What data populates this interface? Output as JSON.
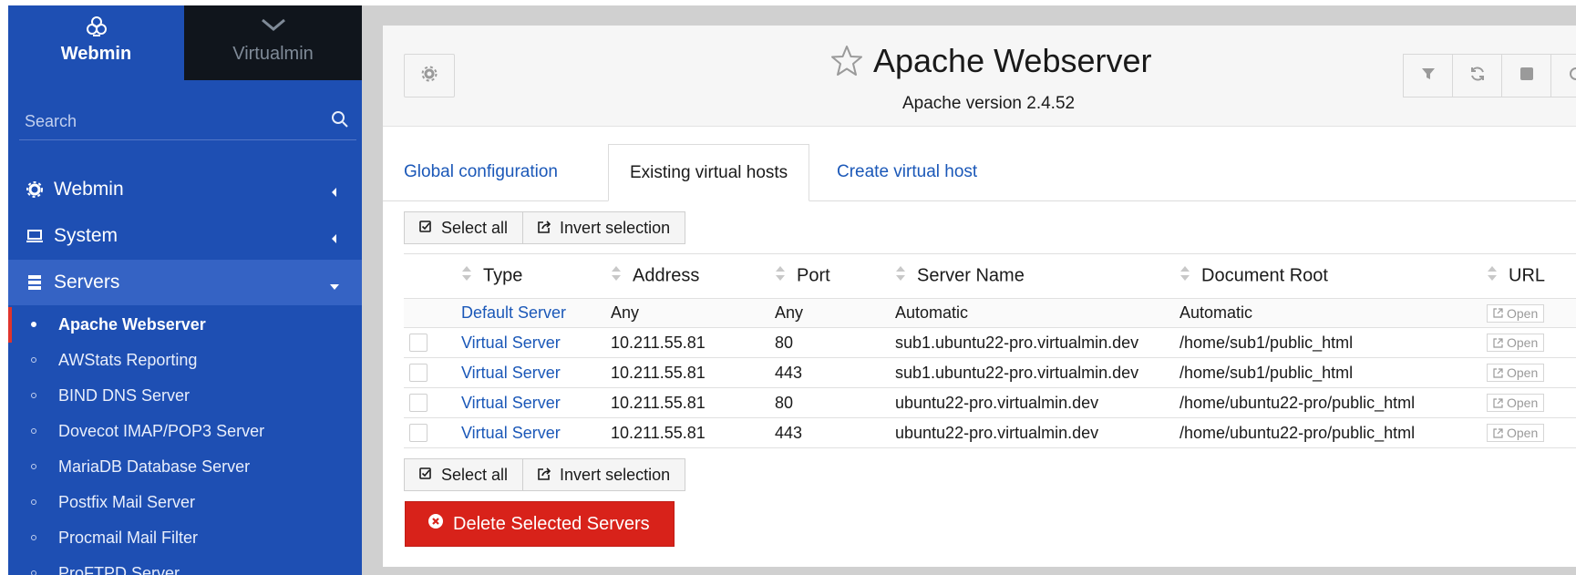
{
  "sidebar": {
    "switch": {
      "webmin_label": "Webmin",
      "virtualmin_label": "Virtualmin"
    },
    "search_placeholder": "Search",
    "sections": [
      {
        "label": "Webmin",
        "icon": "gear-icon"
      },
      {
        "label": "System",
        "icon": "laptop-icon"
      },
      {
        "label": "Servers",
        "icon": "server-icon"
      }
    ],
    "items": [
      "Apache Webserver",
      "AWStats Reporting",
      "BIND DNS Server",
      "Dovecot IMAP/POP3 Server",
      "MariaDB Database Server",
      "Postfix Mail Server",
      "Procmail Mail Filter",
      "ProFTPD Server"
    ],
    "active_item": "Apache Webserver"
  },
  "header": {
    "title": "Apache Webserver",
    "subtitle": "Apache version 2.4.52"
  },
  "tabs": [
    {
      "label": "Global configuration",
      "active": false
    },
    {
      "label": "Existing virtual hosts",
      "active": true
    },
    {
      "label": "Create virtual host",
      "active": false
    }
  ],
  "selection": {
    "select_all": "Select all",
    "invert": "Invert selection"
  },
  "table": {
    "columns": [
      "Type",
      "Address",
      "Port",
      "Server Name",
      "Document Root",
      "URL"
    ],
    "open_label": "Open",
    "rows": [
      {
        "type": "Default Server",
        "address": "Any",
        "port": "Any",
        "server_name": "Automatic",
        "doc_root": "Automatic"
      },
      {
        "type": "Virtual Server",
        "address": "10.211.55.81",
        "port": "80",
        "server_name": "sub1.ubuntu22-pro.virtualmin.dev",
        "doc_root": "/home/sub1/public_html"
      },
      {
        "type": "Virtual Server",
        "address": "10.211.55.81",
        "port": "443",
        "server_name": "sub1.ubuntu22-pro.virtualmin.dev",
        "doc_root": "/home/sub1/public_html"
      },
      {
        "type": "Virtual Server",
        "address": "10.211.55.81",
        "port": "80",
        "server_name": "ubuntu22-pro.virtualmin.dev",
        "doc_root": "/home/ubuntu22-pro/public_html"
      },
      {
        "type": "Virtual Server",
        "address": "10.211.55.81",
        "port": "443",
        "server_name": "ubuntu22-pro.virtualmin.dev",
        "doc_root": "/home/ubuntu22-pro/public_html"
      }
    ]
  },
  "delete_button": "Delete Selected Servers",
  "colors": {
    "sidebar": "#1e4fb3",
    "sidebar_dark": "#10151c",
    "link": "#1b58b8",
    "danger": "#d8221a"
  }
}
